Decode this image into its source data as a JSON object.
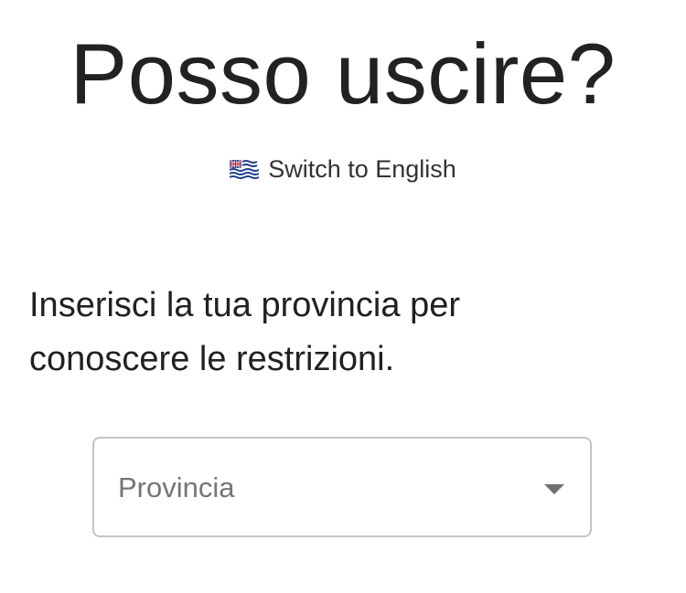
{
  "header": {
    "title": "Posso uscire?"
  },
  "language_switch": {
    "icon": "flag-icon",
    "label": "Switch to English"
  },
  "main": {
    "instruction": "Inserisci la tua provincia per conoscere le restrizioni.",
    "province_select": {
      "placeholder": "Provincia",
      "icon": "chevron-down-icon"
    }
  }
}
